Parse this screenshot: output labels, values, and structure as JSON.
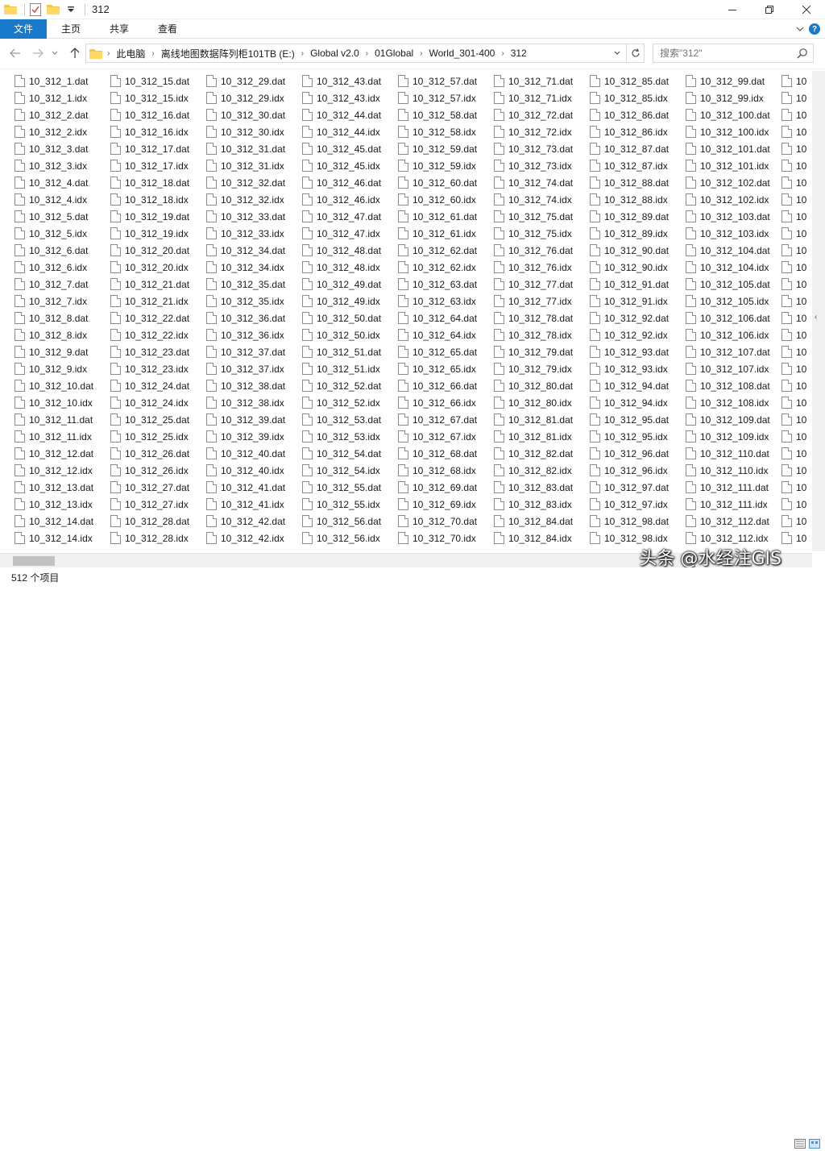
{
  "window": {
    "title": "312"
  },
  "ribbon": {
    "tabs": [
      "文件",
      "主页",
      "共享",
      "查看"
    ]
  },
  "address": {
    "crumbs": [
      "此电脑",
      "离线地图数据阵列柜101TB (E:)",
      "Global v2.0",
      "01Global",
      "World_301-400",
      "312"
    ]
  },
  "search": {
    "placeholder": "搜索\"312\""
  },
  "columns": [
    [
      "10_312_1.dat",
      "10_312_1.idx",
      "10_312_2.dat",
      "10_312_2.idx",
      "10_312_3.dat",
      "10_312_3.idx",
      "10_312_4.dat",
      "10_312_4.idx",
      "10_312_5.dat",
      "10_312_5.idx",
      "10_312_6.dat",
      "10_312_6.idx",
      "10_312_7.dat",
      "10_312_7.idx",
      "10_312_8.dat",
      "10_312_8.idx",
      "10_312_9.dat",
      "10_312_9.idx",
      "10_312_10.dat",
      "10_312_10.idx",
      "10_312_11.dat",
      "10_312_11.idx",
      "10_312_12.dat",
      "10_312_12.idx",
      "10_312_13.dat",
      "10_312_13.idx",
      "10_312_14.dat",
      "10_312_14.idx"
    ],
    [
      "10_312_15.dat",
      "10_312_15.idx",
      "10_312_16.dat",
      "10_312_16.idx",
      "10_312_17.dat",
      "10_312_17.idx",
      "10_312_18.dat",
      "10_312_18.idx",
      "10_312_19.dat",
      "10_312_19.idx",
      "10_312_20.dat",
      "10_312_20.idx",
      "10_312_21.dat",
      "10_312_21.idx",
      "10_312_22.dat",
      "10_312_22.idx",
      "10_312_23.dat",
      "10_312_23.idx",
      "10_312_24.dat",
      "10_312_24.idx",
      "10_312_25.dat",
      "10_312_25.idx",
      "10_312_26.dat",
      "10_312_26.idx",
      "10_312_27.dat",
      "10_312_27.idx",
      "10_312_28.dat",
      "10_312_28.idx"
    ],
    [
      "10_312_29.dat",
      "10_312_29.idx",
      "10_312_30.dat",
      "10_312_30.idx",
      "10_312_31.dat",
      "10_312_31.idx",
      "10_312_32.dat",
      "10_312_32.idx",
      "10_312_33.dat",
      "10_312_33.idx",
      "10_312_34.dat",
      "10_312_34.idx",
      "10_312_35.dat",
      "10_312_35.idx",
      "10_312_36.dat",
      "10_312_36.idx",
      "10_312_37.dat",
      "10_312_37.idx",
      "10_312_38.dat",
      "10_312_38.idx",
      "10_312_39.dat",
      "10_312_39.idx",
      "10_312_40.dat",
      "10_312_40.idx",
      "10_312_41.dat",
      "10_312_41.idx",
      "10_312_42.dat",
      "10_312_42.idx"
    ],
    [
      "10_312_43.dat",
      "10_312_43.idx",
      "10_312_44.dat",
      "10_312_44.idx",
      "10_312_45.dat",
      "10_312_45.idx",
      "10_312_46.dat",
      "10_312_46.idx",
      "10_312_47.dat",
      "10_312_47.idx",
      "10_312_48.dat",
      "10_312_48.idx",
      "10_312_49.dat",
      "10_312_49.idx",
      "10_312_50.dat",
      "10_312_50.idx",
      "10_312_51.dat",
      "10_312_51.idx",
      "10_312_52.dat",
      "10_312_52.idx",
      "10_312_53.dat",
      "10_312_53.idx",
      "10_312_54.dat",
      "10_312_54.idx",
      "10_312_55.dat",
      "10_312_55.idx",
      "10_312_56.dat",
      "10_312_56.idx"
    ],
    [
      "10_312_57.dat",
      "10_312_57.idx",
      "10_312_58.dat",
      "10_312_58.idx",
      "10_312_59.dat",
      "10_312_59.idx",
      "10_312_60.dat",
      "10_312_60.idx",
      "10_312_61.dat",
      "10_312_61.idx",
      "10_312_62.dat",
      "10_312_62.idx",
      "10_312_63.dat",
      "10_312_63.idx",
      "10_312_64.dat",
      "10_312_64.idx",
      "10_312_65.dat",
      "10_312_65.idx",
      "10_312_66.dat",
      "10_312_66.idx",
      "10_312_67.dat",
      "10_312_67.idx",
      "10_312_68.dat",
      "10_312_68.idx",
      "10_312_69.dat",
      "10_312_69.idx",
      "10_312_70.dat",
      "10_312_70.idx"
    ],
    [
      "10_312_71.dat",
      "10_312_71.idx",
      "10_312_72.dat",
      "10_312_72.idx",
      "10_312_73.dat",
      "10_312_73.idx",
      "10_312_74.dat",
      "10_312_74.idx",
      "10_312_75.dat",
      "10_312_75.idx",
      "10_312_76.dat",
      "10_312_76.idx",
      "10_312_77.dat",
      "10_312_77.idx",
      "10_312_78.dat",
      "10_312_78.idx",
      "10_312_79.dat",
      "10_312_79.idx",
      "10_312_80.dat",
      "10_312_80.idx",
      "10_312_81.dat",
      "10_312_81.idx",
      "10_312_82.dat",
      "10_312_82.idx",
      "10_312_83.dat",
      "10_312_83.idx",
      "10_312_84.dat",
      "10_312_84.idx"
    ],
    [
      "10_312_85.dat",
      "10_312_85.idx",
      "10_312_86.dat",
      "10_312_86.idx",
      "10_312_87.dat",
      "10_312_87.idx",
      "10_312_88.dat",
      "10_312_88.idx",
      "10_312_89.dat",
      "10_312_89.idx",
      "10_312_90.dat",
      "10_312_90.idx",
      "10_312_91.dat",
      "10_312_91.idx",
      "10_312_92.dat",
      "10_312_92.idx",
      "10_312_93.dat",
      "10_312_93.idx",
      "10_312_94.dat",
      "10_312_94.idx",
      "10_312_95.dat",
      "10_312_95.idx",
      "10_312_96.dat",
      "10_312_96.idx",
      "10_312_97.dat",
      "10_312_97.idx",
      "10_312_98.dat",
      "10_312_98.idx"
    ],
    [
      "10_312_99.dat",
      "10_312_99.idx",
      "10_312_100.dat",
      "10_312_100.idx",
      "10_312_101.dat",
      "10_312_101.idx",
      "10_312_102.dat",
      "10_312_102.idx",
      "10_312_103.dat",
      "10_312_103.idx",
      "10_312_104.dat",
      "10_312_104.idx",
      "10_312_105.dat",
      "10_312_105.idx",
      "10_312_106.dat",
      "10_312_106.idx",
      "10_312_107.dat",
      "10_312_107.idx",
      "10_312_108.dat",
      "10_312_108.idx",
      "10_312_109.dat",
      "10_312_109.idx",
      "10_312_110.dat",
      "10_312_110.idx",
      "10_312_111.dat",
      "10_312_111.idx",
      "10_312_112.dat",
      "10_312_112.idx"
    ],
    [
      "10",
      "10",
      "10",
      "10",
      "10",
      "10",
      "10",
      "10",
      "10",
      "10",
      "10",
      "10",
      "10",
      "10",
      "10",
      "10",
      "10",
      "10",
      "10",
      "10",
      "10",
      "10",
      "10",
      "10",
      "10",
      "10",
      "10",
      "10"
    ]
  ],
  "status": {
    "item_count": "512 个项目"
  },
  "watermark": "头条 @水经注GIS"
}
